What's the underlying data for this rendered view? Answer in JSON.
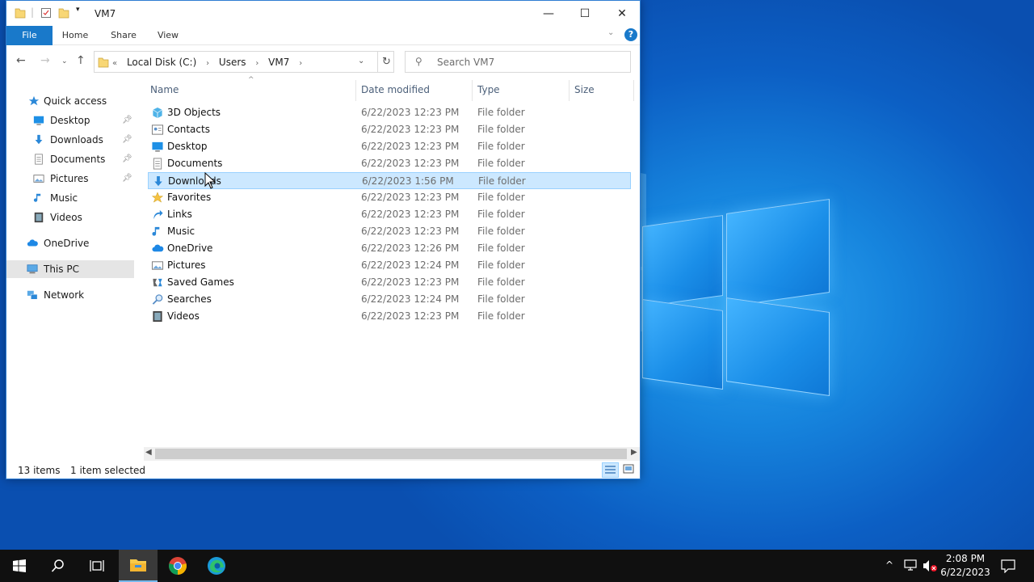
{
  "window": {
    "title": "VM7",
    "controls": {
      "minimize": "—",
      "maximize": "☐",
      "close": "✕"
    }
  },
  "ribbon": {
    "tabs": [
      "File",
      "Home",
      "Share",
      "View"
    ],
    "help": "?"
  },
  "address_bar": {
    "overflow": "«",
    "path": [
      "Local Disk (C:)",
      "Users",
      "VM7"
    ]
  },
  "search": {
    "placeholder": "Search VM7"
  },
  "sidebar": {
    "items": [
      {
        "label": "Quick access",
        "icon": "star-icon"
      },
      {
        "label": "Desktop",
        "icon": "desktop-icon",
        "pinned": true
      },
      {
        "label": "Downloads",
        "icon": "download-icon",
        "pinned": true
      },
      {
        "label": "Documents",
        "icon": "document-icon",
        "pinned": true
      },
      {
        "label": "Pictures",
        "icon": "pictures-icon",
        "pinned": true
      },
      {
        "label": "Music",
        "icon": "music-icon"
      },
      {
        "label": "Videos",
        "icon": "videos-icon"
      },
      {
        "label": "OneDrive",
        "icon": "cloud-icon"
      },
      {
        "label": "This PC",
        "icon": "computer-icon",
        "selected": true
      },
      {
        "label": "Network",
        "icon": "network-icon"
      }
    ]
  },
  "columns": {
    "name": "Name",
    "date": "Date modified",
    "type": "Type",
    "size": "Size"
  },
  "files": [
    {
      "name": "3D Objects",
      "date": "6/22/2023 12:23 PM",
      "type": "File folder"
    },
    {
      "name": "Contacts",
      "date": "6/22/2023 12:23 PM",
      "type": "File folder"
    },
    {
      "name": "Desktop",
      "date": "6/22/2023 12:23 PM",
      "type": "File folder"
    },
    {
      "name": "Documents",
      "date": "6/22/2023 12:23 PM",
      "type": "File folder"
    },
    {
      "name": "Downloads",
      "date": "6/22/2023 1:56 PM",
      "type": "File folder",
      "selected": true
    },
    {
      "name": "Favorites",
      "date": "6/22/2023 12:23 PM",
      "type": "File folder"
    },
    {
      "name": "Links",
      "date": "6/22/2023 12:23 PM",
      "type": "File folder"
    },
    {
      "name": "Music",
      "date": "6/22/2023 12:23 PM",
      "type": "File folder"
    },
    {
      "name": "OneDrive",
      "date": "6/22/2023 12:26 PM",
      "type": "File folder"
    },
    {
      "name": "Pictures",
      "date": "6/22/2023 12:24 PM",
      "type": "File folder"
    },
    {
      "name": "Saved Games",
      "date": "6/22/2023 12:23 PM",
      "type": "File folder"
    },
    {
      "name": "Searches",
      "date": "6/22/2023 12:24 PM",
      "type": "File folder"
    },
    {
      "name": "Videos",
      "date": "6/22/2023 12:23 PM",
      "type": "File folder"
    }
  ],
  "status": {
    "count": "13 items",
    "selection": "1 item selected"
  },
  "taskbar": {
    "clock_time": "2:08 PM",
    "clock_date": "6/22/2023"
  },
  "colors": {
    "accent": "#1979ca",
    "selection": "#cce8ff",
    "taskbar": "#101010"
  }
}
